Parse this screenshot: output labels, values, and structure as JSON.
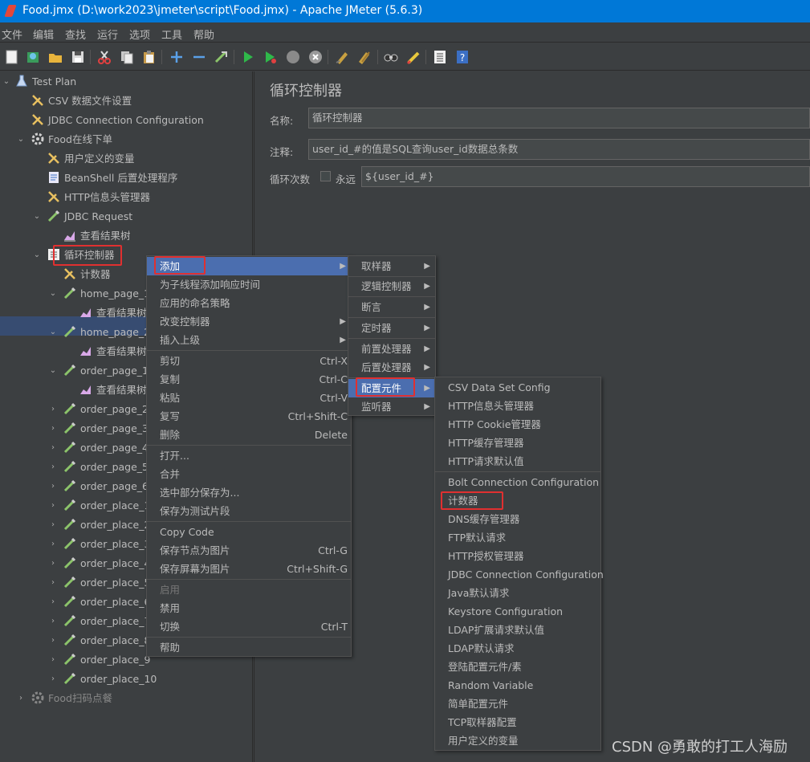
{
  "window": {
    "title": "Food.jmx (D:\\work2023\\jmeter\\script\\Food.jmx) - Apache JMeter (5.6.3)"
  },
  "menubar": [
    "文件",
    "编辑",
    "查找",
    "运行",
    "选项",
    "工具",
    "帮助"
  ],
  "toolbar": {
    "icons": [
      "new-icon",
      "templates-icon",
      "open-icon",
      "save-icon",
      "cut-icon",
      "copy-icon",
      "paste-icon",
      "expand-icon",
      "collapse-icon",
      "toggle-icon",
      "start-icon",
      "start-no-pauses-icon",
      "stop-icon",
      "shutdown-icon",
      "clear-icon",
      "clear-all-icon",
      "search-icon",
      "reset-search-icon",
      "function-helper-icon",
      "help-icon"
    ]
  },
  "tree": {
    "test_plan": "Test Plan",
    "csv": "CSV 数据文件设置",
    "jdbc_conn": "JDBC Connection Configuration",
    "tg1": "Food在线下单",
    "user_vars": "用户定义的变量",
    "beanshell": "BeanShell 后置处理程序",
    "http_header": "HTTP信息头管理器",
    "jdbc_request": "JDBC Request",
    "result_tree": "查看结果树",
    "loop": "循环控制器",
    "counter": "计数器",
    "home_page_1": "home_page_1",
    "result_tree_1": "查看结果树",
    "home_page_2": "home_page_2",
    "result_tree_2": "查看结果树",
    "order_page_1": "order_page_1",
    "result_tree_3": "查看结果树",
    "order_page_2": "order_page_2",
    "order_page_3": "order_page_3",
    "order_page_4": "order_page_4",
    "order_page_5": "order_page_5",
    "order_page_6": "order_page_6",
    "order_place_1": "order_place_1",
    "order_place_2": "order_place_2",
    "order_place_3": "order_place_3",
    "order_place_4": "order_place_4",
    "order_place_5": "order_place_5",
    "order_place_6": "order_place_6",
    "order_place_7": "order_place_7",
    "order_place_8": "order_place_8",
    "order_place_9": "order_place_9",
    "order_place_10": "order_place_10",
    "tg2": "Food扫码点餐"
  },
  "panel": {
    "title": "循环控制器",
    "name_label": "名称:",
    "name_value": "循环控制器",
    "comment_label": "注释:",
    "comment_value": "user_id_#的值是SQL查询user_id数据总条数",
    "loop_label": "循环次数",
    "forever_label": "永远",
    "loop_value": "${user_id_#}"
  },
  "context_menu": {
    "add": "添加",
    "add_think_time": "为子线程添加响应时间",
    "apply_naming": "应用的命名策略",
    "change_controller": "改变控制器",
    "insert_parent": "插入上级",
    "cut": "剪切",
    "cut_acc": "Ctrl-X",
    "copy": "复制",
    "copy_acc": "Ctrl-C",
    "paste": "粘贴",
    "paste_acc": "Ctrl-V",
    "duplicate": "复写",
    "duplicate_acc": "Ctrl+Shift-C",
    "remove": "删除",
    "remove_acc": "Delete",
    "open": "打开...",
    "merge": "合并",
    "save_selection": "选中部分保存为...",
    "save_fragment": "保存为测试片段",
    "copy_code": "Copy Code",
    "save_node_img": "保存节点为图片",
    "save_node_img_acc": "Ctrl-G",
    "save_screen_img": "保存屏幕为图片",
    "save_screen_img_acc": "Ctrl+Shift-G",
    "enable": "启用",
    "disable": "禁用",
    "toggle": "切换",
    "toggle_acc": "Ctrl-T",
    "help": "帮助"
  },
  "add_submenu": {
    "sampler": "取样器",
    "logic": "逻辑控制器",
    "assertion": "断言",
    "timer": "定时器",
    "pre": "前置处理器",
    "post": "后置处理器",
    "config": "配置元件",
    "listener": "监听器"
  },
  "config_submenu": [
    "CSV Data Set Config",
    "HTTP信息头管理器",
    "HTTP Cookie管理器",
    "HTTP缓存管理器",
    "HTTP请求默认值",
    "Bolt Connection Configuration",
    "计数器",
    "DNS缓存管理器",
    "FTP默认请求",
    "HTTP授权管理器",
    "JDBC Connection Configuration",
    "Java默认请求",
    "Keystore Configuration",
    "LDAP扩展请求默认值",
    "LDAP默认请求",
    "登陆配置元件/素",
    "Random Variable",
    "简单配置元件",
    "TCP取样器配置",
    "用户定义的变量"
  ],
  "watermark": "CSDN @勇敢的打工人海励",
  "colors": {
    "accent": "#4b6eaf",
    "highlight_box": "#e03030",
    "title_bar": "#0078d7"
  }
}
